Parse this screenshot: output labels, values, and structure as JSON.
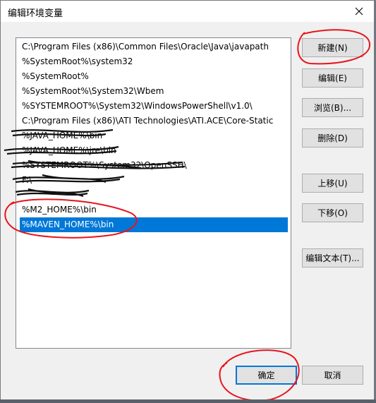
{
  "dialog": {
    "title": "编辑环境变量"
  },
  "list": {
    "items": [
      {
        "text": "C:\\Program Files (x86)\\Common Files\\Oracle\\Java\\javapath",
        "selected": false
      },
      {
        "text": "%SystemRoot%\\system32",
        "selected": false
      },
      {
        "text": "%SystemRoot%",
        "selected": false
      },
      {
        "text": "%SystemRoot%\\System32\\Wbem",
        "selected": false
      },
      {
        "text": "%SYSTEMROOT%\\System32\\WindowsPowerShell\\v1.0\\",
        "selected": false
      },
      {
        "text": "C:\\Program Files (x86)\\ATI Technologies\\ATI.ACE\\Core-Static",
        "selected": false
      },
      {
        "text": "%JAVA_HOME%\\bin",
        "selected": false
      },
      {
        "text": "%JAVA_HOME%\\jre\\bin",
        "selected": false
      },
      {
        "text": "%SYSTEMROOT%\\System32\\OpenSSH\\",
        "selected": false
      },
      {
        "text": "F:\\",
        "selected": false
      },
      {
        "text": "",
        "selected": false
      },
      {
        "text": "%M2_HOME%\\bin",
        "selected": false
      },
      {
        "text": "%MAVEN_HOME%\\bin",
        "selected": true
      }
    ]
  },
  "buttons": {
    "new": "新建(N)",
    "edit": "编辑(E)",
    "browse": "浏览(B)...",
    "delete": "删除(D)",
    "move_up": "上移(U)",
    "move_down": "下移(O)",
    "edit_text": "编辑文本(T)...",
    "ok": "确定",
    "cancel": "取消"
  },
  "colors": {
    "selection": "#0078d7",
    "annotation": "#e8141c",
    "scribble": "#111111"
  },
  "icons": {
    "close": "close-icon"
  }
}
